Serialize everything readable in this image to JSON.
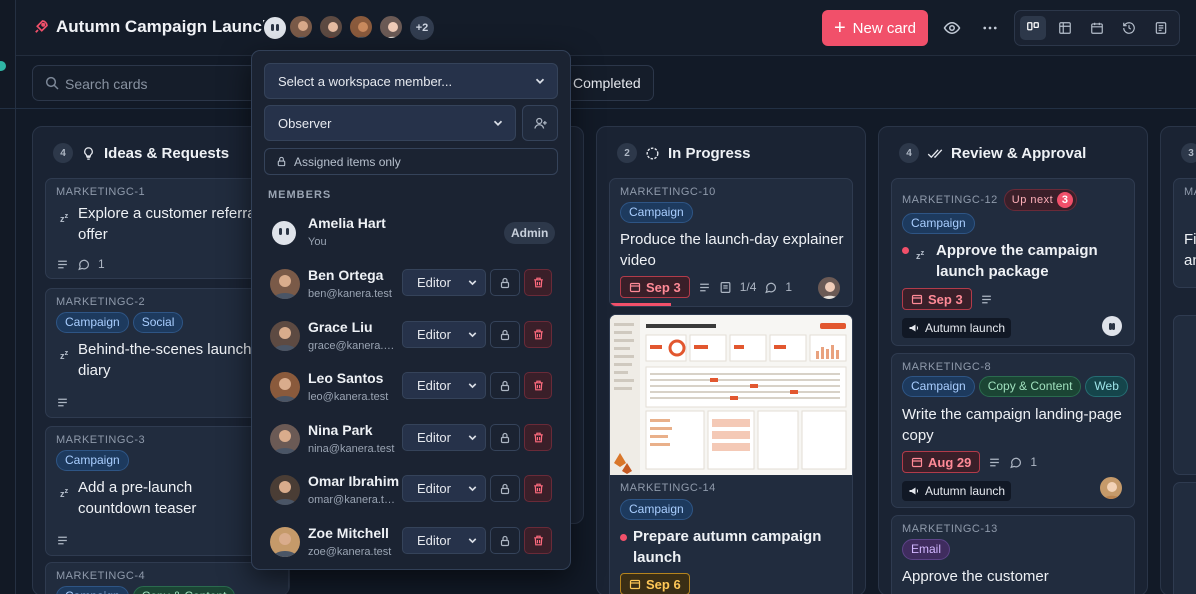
{
  "project": {
    "title": "Autumn Campaign Launch",
    "more_members": "+2"
  },
  "toolbar": {
    "new_card_label": "New card",
    "new_card_plus": "+"
  },
  "search": {
    "placeholder": "Search cards"
  },
  "filter": {
    "completed_label": "Completed"
  },
  "columns": [
    {
      "title": "Ideas & Requests",
      "count": "4",
      "cards": [
        {
          "id": "MARKETINGC-1",
          "title": "Explore a customer referral offer",
          "comments": "1"
        },
        {
          "id": "MARKETINGC-2",
          "tags": [
            "Campaign",
            "Social"
          ],
          "title": "Behind-the-scenes launch diary"
        },
        {
          "id": "MARKETINGC-3",
          "tags": [
            "Campaign"
          ],
          "title": "Add a pre-launch countdown teaser"
        },
        {
          "id": "MARKETINGC-4",
          "tags": [
            "Campaign",
            "Copy & Content"
          ]
        }
      ]
    },
    {
      "title": "In Progress",
      "count": "2",
      "cards": [
        {
          "id": "MARKETINGC-10",
          "tags": [
            "Campaign"
          ],
          "title": "Produce the launch-day explainer video",
          "date": "Sep 3",
          "checklist": "1/4",
          "comments": "1",
          "progress": 0.25
        },
        {
          "id": "MARKETINGC-14",
          "tags": [
            "Campaign"
          ],
          "title": "Prepare autumn campaign launch",
          "date": "Sep 6"
        }
      ]
    },
    {
      "title": "Review & Approval",
      "count": "4",
      "cards": [
        {
          "id": "MARKETINGC-12",
          "upnext": "Up next",
          "upnext_count": "3",
          "tags": [
            "Campaign"
          ],
          "title": "Approve the campaign launch package",
          "date": "Sep 3",
          "label": "Autumn launch"
        },
        {
          "id": "MARKETINGC-8",
          "tags": [
            "Campaign",
            "Copy & Content",
            "Web"
          ],
          "title": "Write the campaign landing-page copy",
          "date": "Aug 29",
          "comments": "1",
          "label": "Autumn launch"
        },
        {
          "id": "MARKETINGC-13",
          "tags": [
            "Email"
          ],
          "title": "Approve the customer"
        }
      ]
    },
    {
      "title": "",
      "count": "3",
      "cards": [
        {
          "id": "MARKETINGC-",
          "title": "Fi an"
        }
      ]
    }
  ],
  "popup": {
    "member_select": "Select a workspace member...",
    "role_select": "Observer",
    "assigned_only": "Assigned items only",
    "members_heading": "MEMBERS",
    "members": [
      {
        "name": "Amelia Hart",
        "email": "You",
        "role": "Admin",
        "avatar_color": "#dfe3ea"
      },
      {
        "name": "Ben Ortega",
        "email": "ben@kanera.test",
        "role": "Editor",
        "avatar_color": "#7a5a48"
      },
      {
        "name": "Grace Liu",
        "email": "grace@kanera.test",
        "role": "Editor",
        "avatar_color": "#5d4a42"
      },
      {
        "name": "Leo Santos",
        "email": "leo@kanera.test",
        "role": "Editor",
        "avatar_color": "#8a5a3c"
      },
      {
        "name": "Nina Park",
        "email": "nina@kanera.test",
        "role": "Editor",
        "avatar_color": "#6b5a55"
      },
      {
        "name": "Omar Ibrahim",
        "email": "omar@kanera.test",
        "role": "Editor",
        "avatar_color": "#4a3d35"
      },
      {
        "name": "Zoe Mitchell",
        "email": "zoe@kanera.test",
        "role": "Editor",
        "avatar_color": "#c59a6a"
      }
    ]
  },
  "colors": {
    "accent": "#f1506a",
    "background": "#121a27",
    "column": "#1a2333",
    "card": "#212c3e"
  }
}
